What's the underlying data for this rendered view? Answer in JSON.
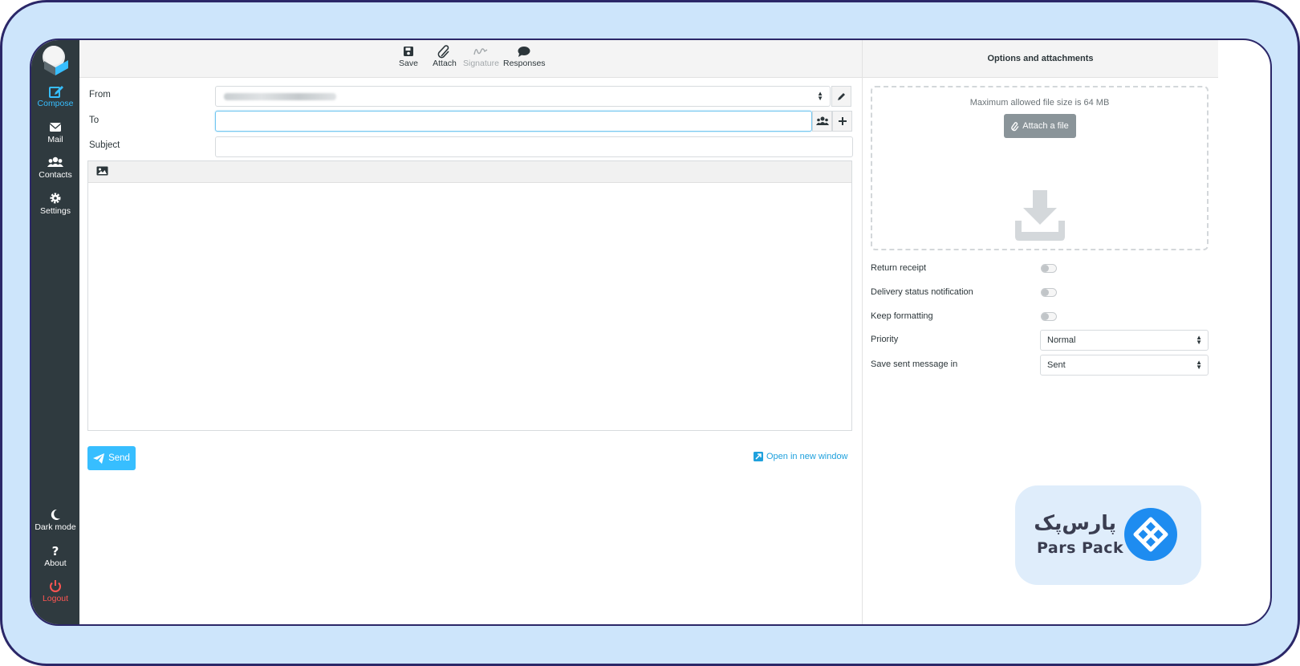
{
  "sidebar": {
    "items": [
      {
        "id": "compose",
        "label": "Compose",
        "icon": "compose-icon"
      },
      {
        "id": "mail",
        "label": "Mail",
        "icon": "envelope-icon"
      },
      {
        "id": "contacts",
        "label": "Contacts",
        "icon": "users-icon"
      },
      {
        "id": "settings",
        "label": "Settings",
        "icon": "gear-icon"
      }
    ],
    "bottom": [
      {
        "id": "darkmode",
        "label": "Dark mode",
        "icon": "moon-icon"
      },
      {
        "id": "about",
        "label": "About",
        "icon": "question-icon"
      },
      {
        "id": "logout",
        "label": "Logout",
        "icon": "power-icon"
      }
    ],
    "active": "compose"
  },
  "toolbar": {
    "save_label": "Save",
    "attach_label": "Attach",
    "signature_label": "Signature",
    "responses_label": "Responses"
  },
  "form": {
    "from_label": "From",
    "to_label": "To",
    "subject_label": "Subject",
    "to_value": "",
    "subject_value": ""
  },
  "actions": {
    "send_label": "Send",
    "open_new_label": "Open in new window"
  },
  "options": {
    "header": "Options and attachments",
    "max_size": "Maximum allowed file size is 64 MB",
    "attach_file_label": "Attach a file",
    "return_receipt": "Return receipt",
    "delivery_status": "Delivery status notification",
    "keep_formatting": "Keep formatting",
    "priority_label": "Priority",
    "priority_value": "Normal",
    "save_sent_label": "Save sent message in",
    "save_sent_value": "Sent"
  },
  "brand": {
    "name_fa": "پارس‌پک",
    "name_en": "Pars Pack"
  },
  "colors": {
    "accent": "#37beff",
    "sidebar": "#2f3a3f",
    "logout": "#ff5552",
    "frame_bg": "#cde5fb",
    "brand": "#1e8cf0"
  }
}
